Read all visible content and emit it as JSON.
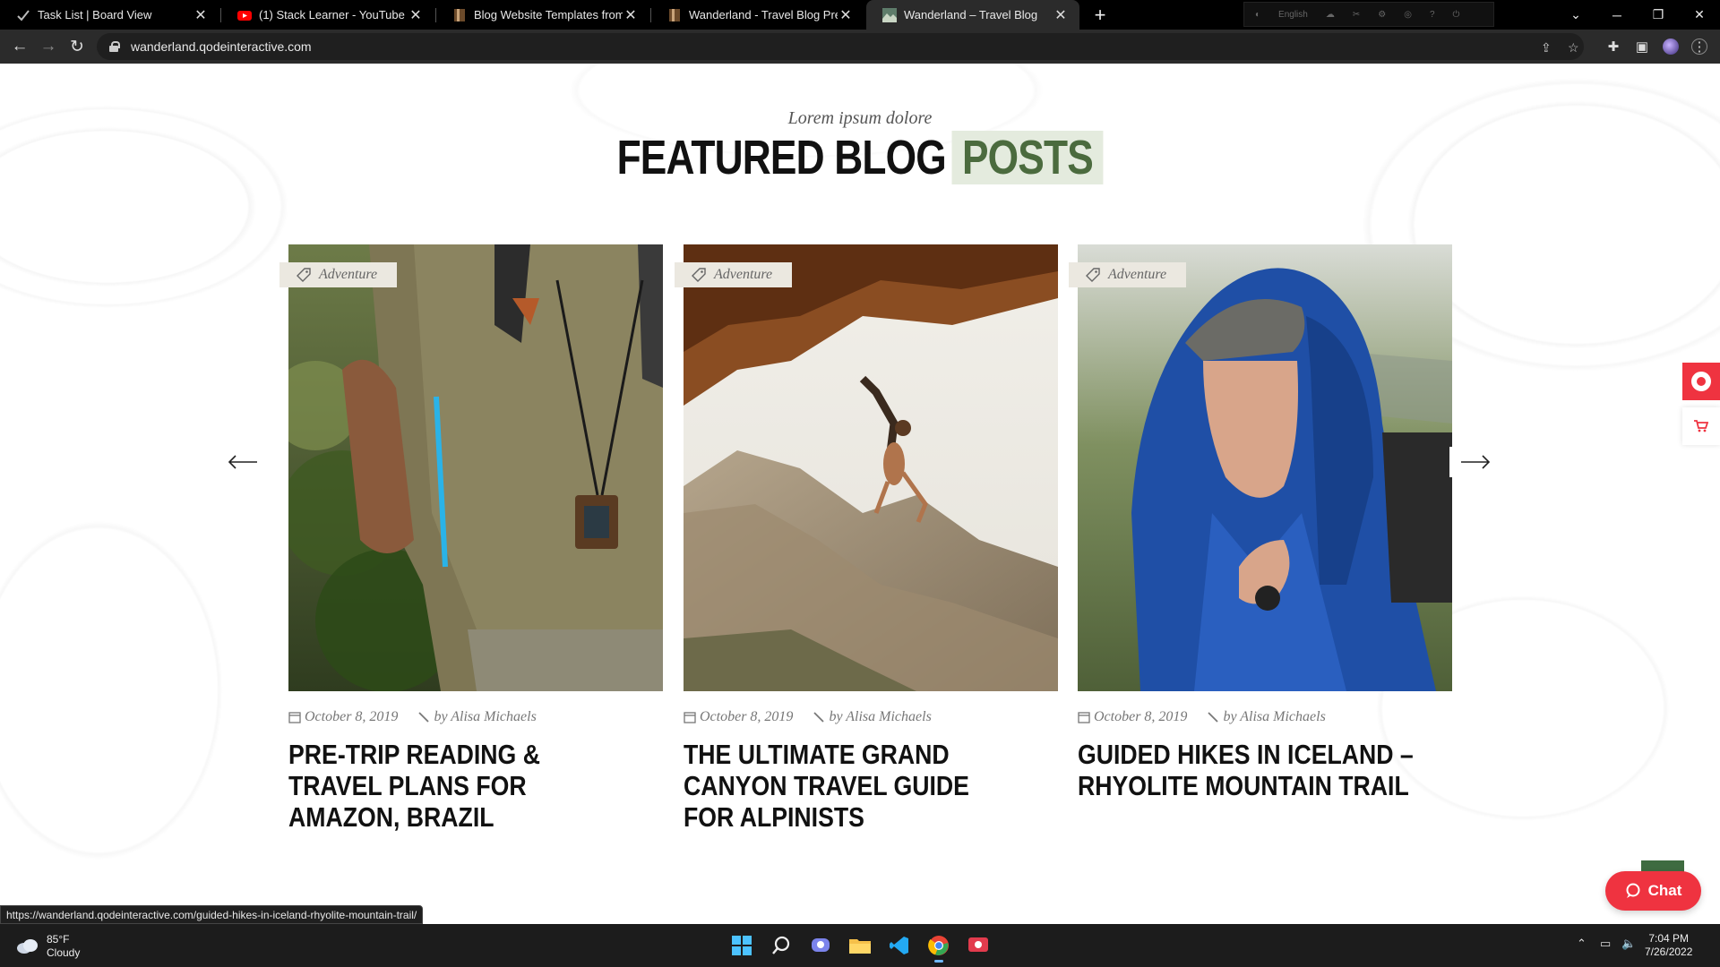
{
  "browser": {
    "tabs": [
      {
        "title": "Task List | Board View",
        "icon": "checkmark-icon"
      },
      {
        "title": "(1) Stack Learner - YouTube",
        "icon": "youtube-icon"
      },
      {
        "title": "Blog Website Templates from The",
        "icon": "themeforest-icon"
      },
      {
        "title": "Wanderland - Travel Blog Preview",
        "icon": "themeforest-icon"
      },
      {
        "title": "Wanderland – Travel Blog",
        "icon": "wanderland-icon",
        "active": true
      }
    ],
    "new_tab": "+",
    "extension_label": "English",
    "url": "wanderland.qodeinteractive.com"
  },
  "page": {
    "subtitle": "Lorem ipsum dolore",
    "heading_main": "FEATURED BLOG",
    "heading_highlight": "POSTS",
    "accent_color": "#4b6b3e",
    "posts": [
      {
        "category": "Adventure",
        "date": "October 8, 2019",
        "author": "by Alisa Michaels",
        "title": "Pre-Trip Reading & Travel Plans for Amazon, Brazil",
        "image": "hiker-photo"
      },
      {
        "category": "Adventure",
        "date": "October 8, 2019",
        "author": "by Alisa Michaels",
        "title": "The Ultimate Grand Canyon Travel Guide for Alpinists",
        "image": "climber-photo"
      },
      {
        "category": "Adventure",
        "date": "October 8, 2019",
        "author": "by Alisa Michaels",
        "title": "Guided Hikes in Iceland – Rhyolite Mountain Trail",
        "image": "raincoat-man-photo"
      }
    ],
    "chat_label": "Chat"
  },
  "status_bar_url": "https://wanderland.qodeinteractive.com/guided-hikes-in-iceland-rhyolite-mountain-trail/",
  "taskbar": {
    "temperature": "85°F",
    "condition": "Cloudy",
    "time": "7:04 PM",
    "date": "7/26/2022"
  }
}
